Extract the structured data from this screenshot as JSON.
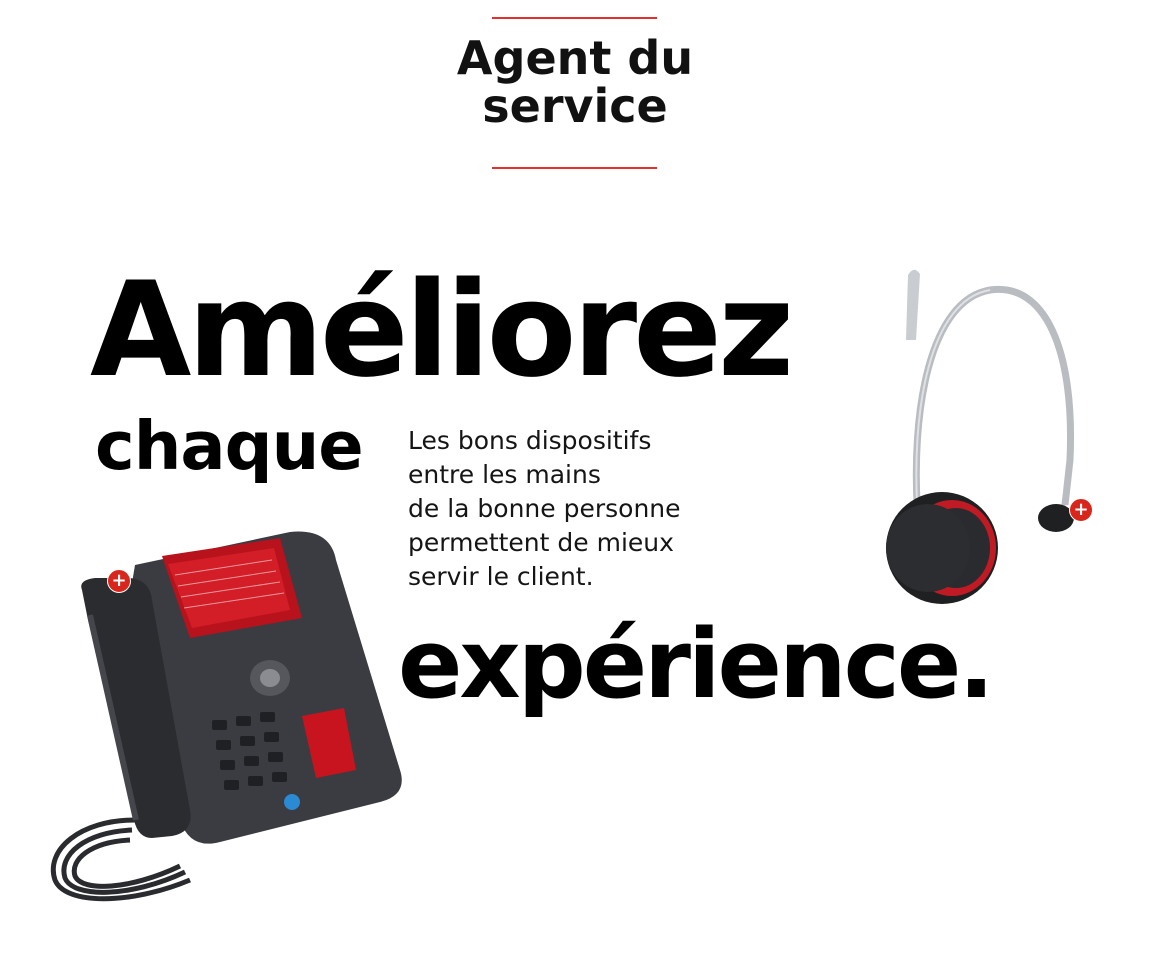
{
  "header": {
    "title_line1": "Agent du",
    "title_line2": "service"
  },
  "headline": {
    "word1": "Améliorez",
    "word2": "chaque",
    "word3": "expérience."
  },
  "body_copy": {
    "lines": [
      "Les bons dispositifs",
      "entre les mains",
      "de la bonne personne",
      "permettent de mieux",
      "servir le client."
    ]
  },
  "colors": {
    "accent": "#e0332f",
    "text": "#000000",
    "device_body": "#3a3c42",
    "screen_red": "#c8141e"
  },
  "icons": {
    "phone_badge": "plus-icon",
    "headset_badge": "plus-icon"
  }
}
